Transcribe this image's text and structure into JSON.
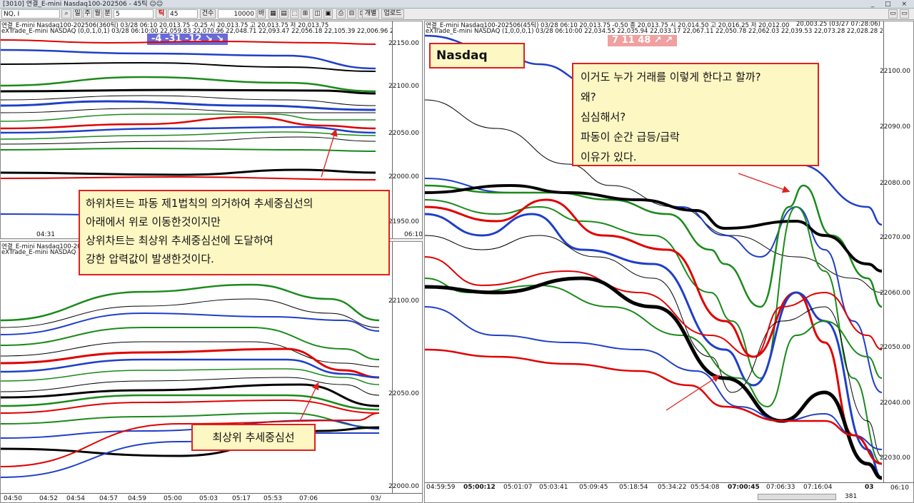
{
  "window": {
    "title": "[3010] 연결_E-mini Nasdaq100-202506 - 45틱 ☺☺",
    "controls": "_ □ ×"
  },
  "toolbar": {
    "symbol": "NQ, I",
    "period_buttons": [
      "일",
      "주",
      "월",
      "분"
    ],
    "period_value": "5",
    "tick_label": "틱",
    "tick_value": "45",
    "count_label": "건수",
    "count_value": "10000",
    "count_suffix": "바",
    "separate_label": "개별",
    "upload_label": "업로드"
  },
  "colors": {
    "red": "#e00000",
    "green": "#1a8a1a",
    "blue": "#1f3fc8",
    "black": "#000000",
    "note_border": "#e02020",
    "note_bg": "#fdf7c3"
  },
  "panels": {
    "top_left": {
      "title_line1": "연결_E-mini Nasdaq100-202506(360틱) 03/28 06:10  20,013.75  -0.25  시 20,013.75 고 20,013.75 저 20,013.75",
      "title_line2": "eXTrade_E-mini NASDAQ  (0,0,1,0,1) 03/28 06:10:00 22,059.83 22,070.96 22,048.71 22,093.47 22,056.18 22,105.39 22,006.96 22,154.67",
      "badge": "-4  -31  -12 ↘ ↘",
      "y_labels": [
        "22150.00",
        "22100.00",
        "22050.00",
        "22000.00",
        "21950.00"
      ],
      "x_labels": [
        "04:31",
        "06:10"
      ]
    },
    "bottom_left": {
      "title_line1": "연결_E-mini Nasdaq100-202506(...)",
      "title_line2": "eXTrade_E-mini NASDAQ",
      "y_labels": [
        "22100.00",
        "22050.00",
        "22000.00"
      ],
      "x_labels": [
        "04:50",
        "04:52",
        "04:54",
        "04:57",
        "04:59",
        "05:00",
        "05:03",
        "05:17",
        "05:53",
        "07:06",
        "03/"
      ]
    },
    "right": {
      "title_line1": "연결_E-mini Nasdaq100-202506(45틱) 03/28 06:10  20,013.75  -0.50  종 20,013.75  시 20,014.50 고 20,016.25 저 20,012.00",
      "title_line2": "eXTrade_E-mini NASDAQ  (1,0,0,0,1) 03/28 06:10:00 22,034.55 22,035.94 22,033.17 22,067.11 22,050.78 22,062.03 22,039.53 22,073.28 22,028.28 22,027.37",
      "title_right": "20,003.25 (03/27 07:28:06)",
      "badge": "7  11  48 ↗ ↗",
      "label": "Nasdaq",
      "y_labels": [
        "22100.00",
        "22090.00",
        "22080.00",
        "22070.00",
        "22060.00",
        "22050.00",
        "22040.00",
        "22030.00"
      ],
      "x_labels": [
        "04:59:59",
        "05:00:12",
        "05:01:07",
        "05:03:41",
        "05:09:45",
        "05:18:54",
        "05:34:22",
        "05:54:08",
        "07:00:45",
        "07:06:33",
        "07:16:04",
        "03"
      ],
      "bar_count": "381",
      "last_time": "06:10"
    }
  },
  "notes": {
    "note1": {
      "lines": [
        "하위차트는 파동 제1법칙의 의거하여 추세중심선의",
        "아래에서 위로 이동한것이지만",
        "상위차트는 최상위 추세중심선에 도달하여",
        "강한 압력값이 발생한것이다."
      ]
    },
    "note2": {
      "text": "최상위 추세중심선"
    },
    "note3": {
      "lines": [
        "이거도 누가 거래를 이렇게 한다고 할까?",
        "왜?",
        "심심해서?",
        "파동이 순간 급등/급락",
        "이유가 있다."
      ]
    }
  }
}
